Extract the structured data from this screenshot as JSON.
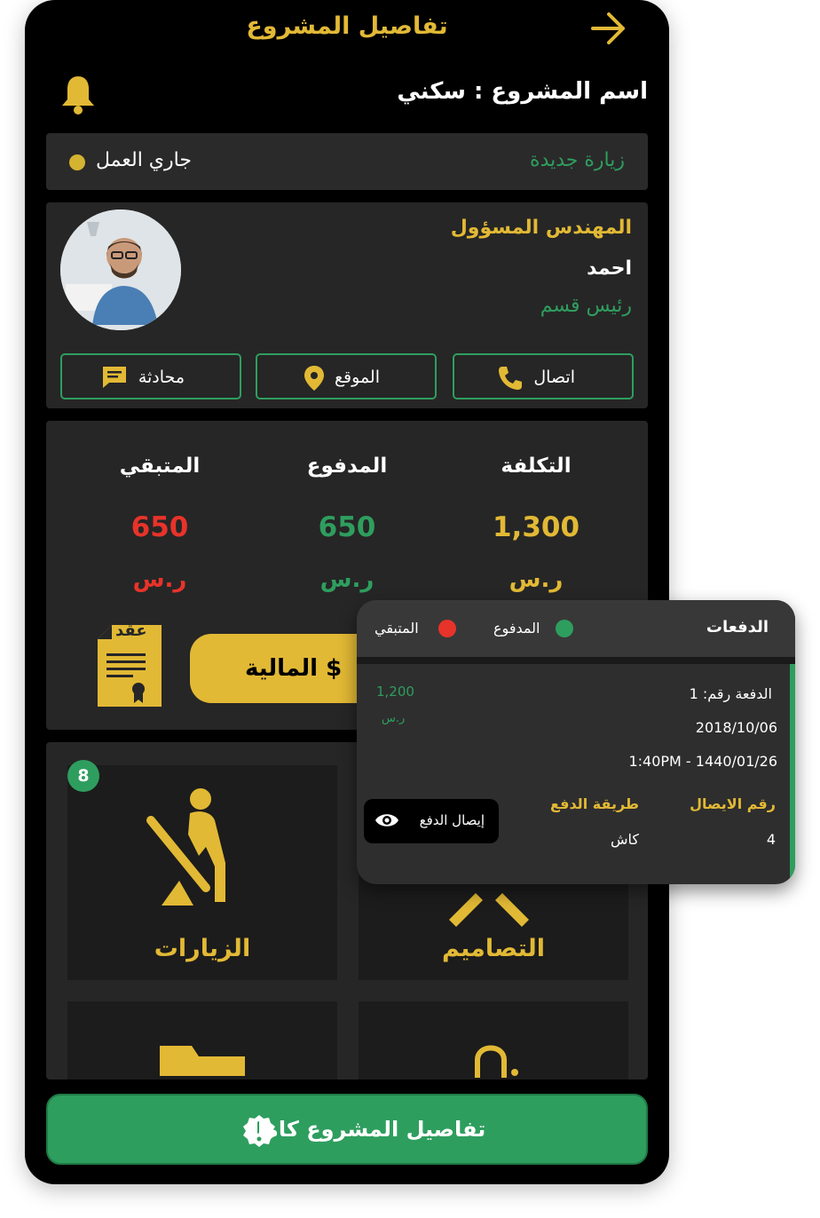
{
  "header": {
    "title": "تفاصيل المشروع",
    "back_icon": "arrow-right-icon"
  },
  "project": {
    "name_label": "اسم المشروع : سكني",
    "bell_icon": "bell-icon"
  },
  "status": {
    "new_visit": "زيارة جديدة",
    "state": "جاري العمل",
    "state_color": "#d4b331"
  },
  "engineer": {
    "role": "المهندس المسؤول",
    "name": "احمد",
    "position": "رئيس قسم",
    "actions": {
      "call": "اتصال",
      "location": "الموقع",
      "chat": "محادثة"
    }
  },
  "finance": {
    "cost_label": "التكلفة",
    "cost_value": "1,300",
    "paid_label": "المدفوع",
    "paid_value": "650",
    "remaining_label": "المتبقي",
    "remaining_value": "650",
    "currency": "ر.س",
    "button_label": "المالية $",
    "contract_label": "عقد"
  },
  "tiles": {
    "visits_label": "الزيارات",
    "visits_badge": "8",
    "designs_label": "التصاميم"
  },
  "footer": {
    "full_details": "تفاصيل المشروع كاملة"
  },
  "payments_popup": {
    "title": "الدفعات",
    "legend_paid": "المدفوع",
    "legend_remaining": "المتبقي",
    "payment_no": "الدفعة رقم: 1",
    "date": "2018/10/06",
    "time": "1:40PM - 1440/01/26",
    "amount": "1,200",
    "currency": "ر.س",
    "receipt_no_label": "رقم الايصال",
    "receipt_no": "4",
    "method_label": "طريقة الدفع",
    "method": "كاش",
    "receipt_button": "إيصال الدفع"
  },
  "colors": {
    "gold": "#e2b935",
    "green": "#2e9e5e",
    "red": "#e8332a",
    "background": "#000000"
  }
}
